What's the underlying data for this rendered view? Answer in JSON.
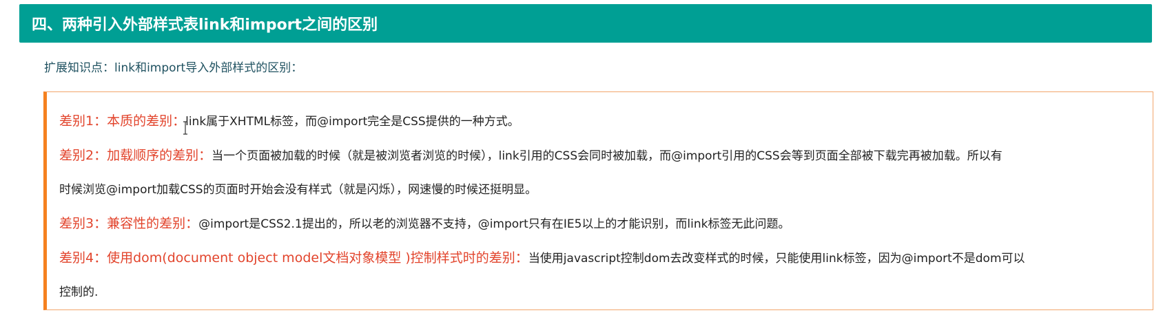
{
  "header": {
    "title": "四、两种引入外部样式表link和import之间的区别"
  },
  "intro": "扩展知识点：link和import导入外部样式的区别：",
  "notes": [
    {
      "label": "差别1：本质的差别：",
      "text": "link属于XHTML标签，而@import完全是CSS提供的一种方式。"
    },
    {
      "label": "差别2：加载顺序的差别：",
      "text": "当一个页面被加载的时候（就是被浏览者浏览的时候），link引用的CSS会同时被加载，而@import引用的CSS会等到页面全部被下载完再被加载。所以有",
      "continuation": "时候浏览@import加载CSS的页面时开始会没有样式（就是闪烁），网速慢的时候还挺明显。"
    },
    {
      "label": "差别3：兼容性的差别：",
      "text": "@import是CSS2.1提出的，所以老的浏览器不支持，@import只有在IE5以上的才能识别，而link标签无此问题。"
    },
    {
      "label": "差别4：使用dom(document object model文档对象模型 )控制样式时的差别：",
      "text": "当使用javascript控制dom去改变样式的时候，只能使用link标签，因为@import不是dom可以",
      "continuation": "控制的."
    }
  ],
  "colors": {
    "header_bg": "#009f94",
    "label_red": "#e2442c",
    "box_accent": "#f5811f",
    "intro_text": "#1f5160"
  },
  "icons": {
    "cursor": "text-cursor-icon"
  }
}
